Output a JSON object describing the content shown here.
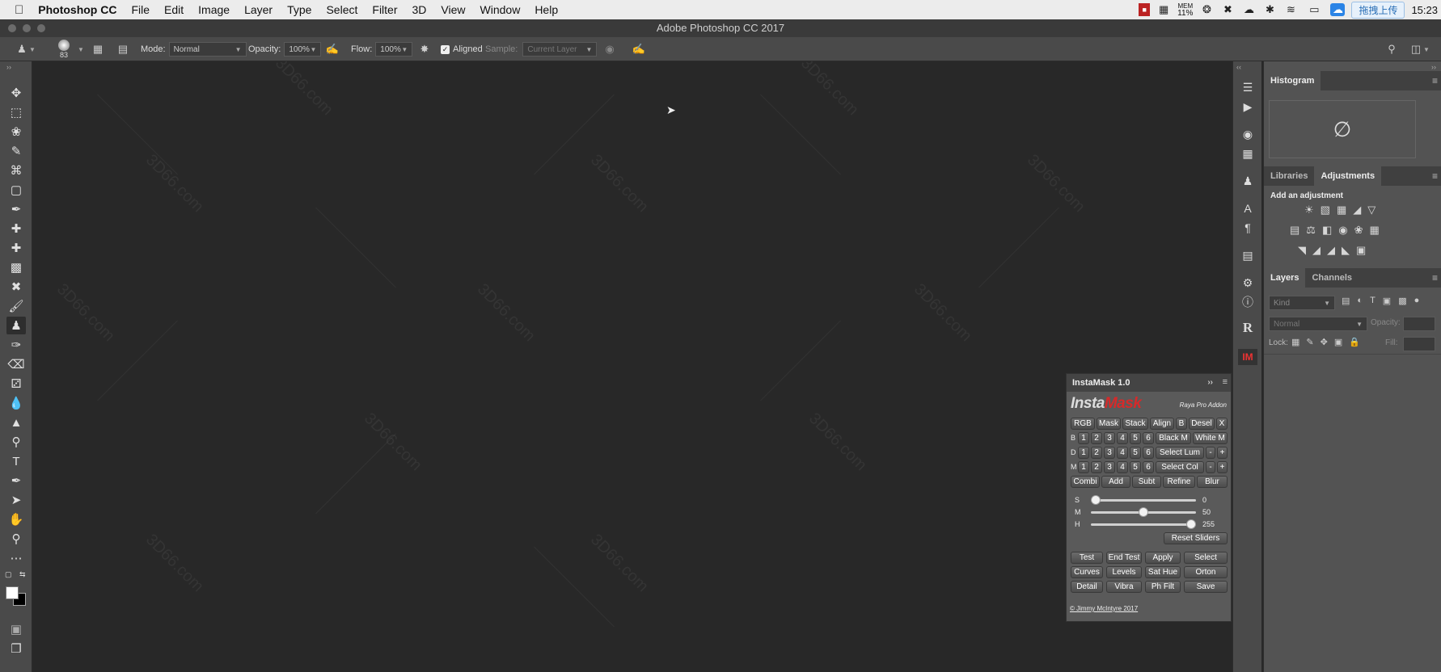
{
  "menubar": {
    "app": "Photoshop CC",
    "items": [
      "File",
      "Edit",
      "Image",
      "Layer",
      "Type",
      "Select",
      "Filter",
      "3D",
      "View",
      "Window",
      "Help"
    ],
    "mem_label": "MEM",
    "mem_value": "11%",
    "upload_label": "拖拽上传",
    "clock": "15:23"
  },
  "window": {
    "title": "Adobe Photoshop CC 2017"
  },
  "options": {
    "brush_size": "83",
    "mode_label": "Mode:",
    "mode_value": "Normal",
    "opacity_label": "Opacity:",
    "opacity_value": "100%",
    "flow_label": "Flow:",
    "flow_value": "100%",
    "aligned_label": "Aligned",
    "sample_label": "Sample:",
    "sample_value": "Current Layer"
  },
  "watermark": "3D66.com",
  "panels": {
    "histogram_tab": "Histogram",
    "libraries_tab": "Libraries",
    "adjustments_tab": "Adjustments",
    "add_adjustment": "Add an adjustment",
    "layers_tab": "Layers",
    "channels_tab": "Channels",
    "kind_placeholder": "Kind",
    "blend_mode": "Normal",
    "opacity_label": "Opacity:",
    "lock_label": "Lock:",
    "fill_label": "Fill:"
  },
  "instamask": {
    "title": "InstaMask 1.0",
    "logo_a": "Insta",
    "logo_b": "Mask",
    "addon": "Raya Pro Addon",
    "row1": [
      "RGB",
      "Mask",
      "Stack",
      "Align",
      "B",
      "Desel",
      "X"
    ],
    "row_b_label": "B",
    "row_d_label": "D",
    "row_m_label": "M",
    "numbers": [
      "1",
      "2",
      "3",
      "4",
      "5",
      "6"
    ],
    "black_m": "Black M",
    "white_m": "White M",
    "select_lum": "Select Lum",
    "select_col": "Select Col",
    "minus": "-",
    "plus": "+",
    "row5": [
      "Combi",
      "Add",
      "Subt",
      "Refine",
      "Blur"
    ],
    "s_label": "S",
    "s_value": "0",
    "m_label": "M",
    "m_value": "50",
    "h_label": "H",
    "h_value": "255",
    "reset_sliders": "Reset Sliders",
    "row6": [
      "Test",
      "End Test",
      "Apply",
      "Select"
    ],
    "row7": [
      "Curves",
      "Levels",
      "Sat Hue",
      "Orton"
    ],
    "row8": [
      "Detail",
      "Vibra",
      "Ph Filt",
      "Save"
    ],
    "copyright": "© Jimmy McIntyre 2017",
    "slider_levels": {
      "s": 0,
      "m": 50,
      "h": 255
    },
    "slider_max": 255
  },
  "colors": {
    "accent_red": "#d62a2a",
    "panel_bg": "#535353",
    "canvas": "#282828"
  }
}
